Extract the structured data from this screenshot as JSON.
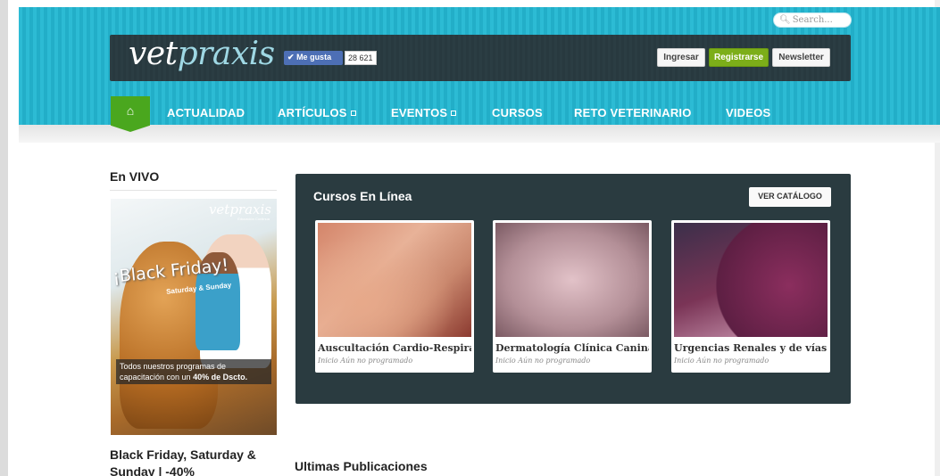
{
  "header": {
    "search_placeholder": "Search...",
    "logo": {
      "part1": "vet",
      "part2": "praxis"
    },
    "facebook": {
      "like_label": "Me gusta",
      "count": "28 621"
    },
    "buttons": {
      "login": "Ingresar",
      "register": "Registrarse",
      "newsletter": "Newsletter"
    },
    "colors": {
      "band": "#27b5cf",
      "bar": "#2b3d43",
      "home": "#4aa71e",
      "register": "#7cae19"
    }
  },
  "nav": {
    "home_icon": "home-icon",
    "items": [
      {
        "label": "ACTUALIDAD"
      },
      {
        "label": "ARTÍCULOS"
      },
      {
        "label": "EVENTOS"
      },
      {
        "label": "CURSOS"
      },
      {
        "label": "RETO VETERINARIO"
      },
      {
        "label": "VIDEOS"
      }
    ]
  },
  "sidebar": {
    "title": "En VIVO",
    "promo": {
      "brand": "vetpraxis",
      "brand_sub": "Educación Continua",
      "headline": "¡Black Friday!",
      "subhead": "Saturday & Sunday",
      "caption_prefix": "Todos nuestros programas de capacitación con un ",
      "caption_bold": "40% de Dscto."
    },
    "post_title": "Black Friday, Saturday & Sunday | -40%"
  },
  "cursos": {
    "title": "Cursos En Línea",
    "catalog_button": "VER CATÁLOGO",
    "cards": [
      {
        "title": "Auscultación Cardio-Respiratoria",
        "meta": "Inicio Aún no programado"
      },
      {
        "title": "Dermatología Clínica Canina",
        "meta": "Inicio Aún no programado"
      },
      {
        "title": "Urgencias Renales y de vías urinarias",
        "meta": "Inicio Aún no programado"
      }
    ]
  },
  "ultimas": {
    "title": "Ultimas Publicaciones"
  }
}
